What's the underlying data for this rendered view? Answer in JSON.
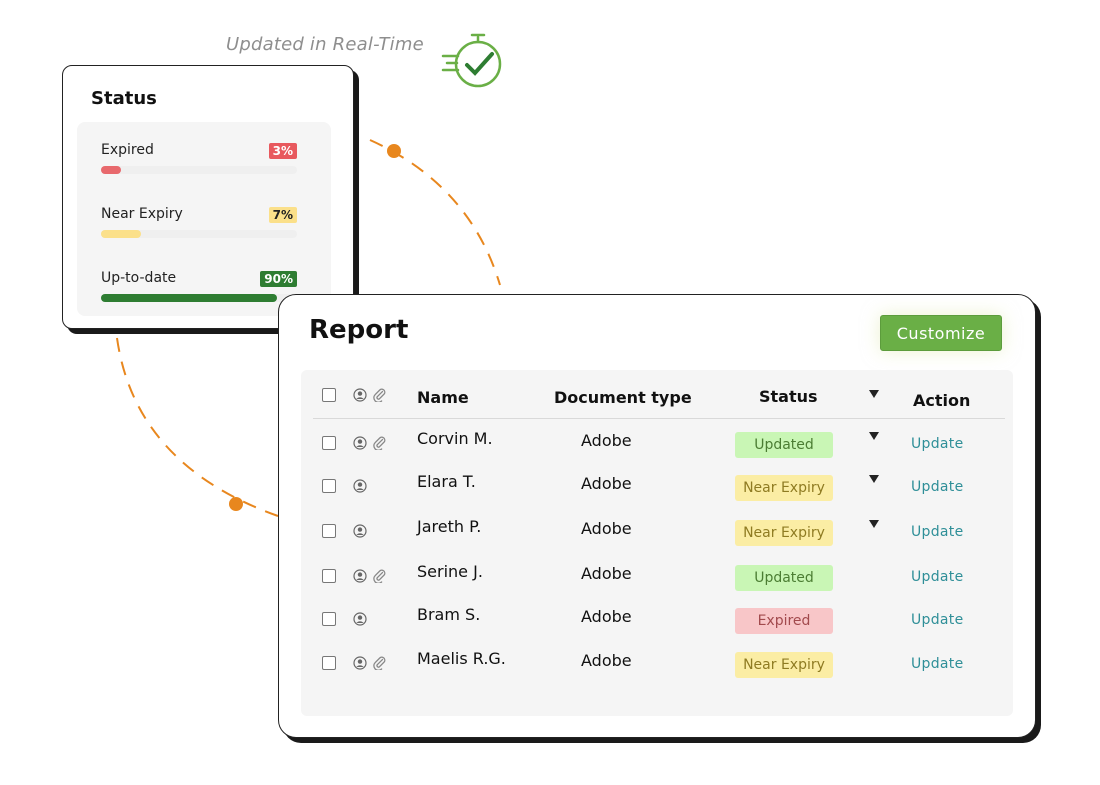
{
  "tagline": "Updated in Real-Time",
  "colors": {
    "accent_orange": "#e8871e",
    "brand_green": "#6aaf46",
    "updated_bg": "#c9f6b5",
    "near_bg": "#fbeda4",
    "expired_bg": "#f8c6c8",
    "link_teal": "#2f8f98"
  },
  "status_card": {
    "title": "Status",
    "items": [
      {
        "label": "Expired",
        "percent_label": "3%",
        "percent": 3,
        "color": "#e8696d",
        "badge_bg": "#e8595e",
        "badge_fg": "#ffffff"
      },
      {
        "label": "Near Expiry",
        "percent_label": "7%",
        "percent": 7,
        "color": "#fbe08a",
        "badge_bg": "#fbe08a",
        "badge_fg": "#222222"
      },
      {
        "label": "Up-to-date",
        "percent_label": "90%",
        "percent": 90,
        "color": "#2e7d32",
        "badge_bg": "#2e7d32",
        "badge_fg": "#ffffff"
      }
    ]
  },
  "report": {
    "title": "Report",
    "customize_label": "Customize",
    "columns": {
      "name": "Name",
      "doc_type": "Document type",
      "status": "Status",
      "action": "Action"
    },
    "rows": [
      {
        "name": "Corvin M.",
        "doc_type": "Adobe",
        "status": "Updated",
        "kind": "updated",
        "attachment": true,
        "caret": true,
        "action": "Update"
      },
      {
        "name": "Elara T.",
        "doc_type": "Adobe",
        "status": "Near Expiry",
        "kind": "near",
        "attachment": false,
        "caret": true,
        "action": "Update"
      },
      {
        "name": "Jareth P.",
        "doc_type": "Adobe",
        "status": "Near Expiry",
        "kind": "near",
        "attachment": false,
        "caret": true,
        "action": "Update"
      },
      {
        "name": "Serine J.",
        "doc_type": "Adobe",
        "status": "Updated",
        "kind": "updated",
        "attachment": true,
        "caret": false,
        "action": "Update"
      },
      {
        "name": "Bram S.",
        "doc_type": "Adobe",
        "status": "Expired",
        "kind": "expired",
        "attachment": false,
        "caret": false,
        "action": "Update"
      },
      {
        "name": "Maelis R.G.",
        "doc_type": "Adobe",
        "status": "Near Expiry",
        "kind": "near",
        "attachment": true,
        "caret": false,
        "action": "Update"
      }
    ]
  }
}
